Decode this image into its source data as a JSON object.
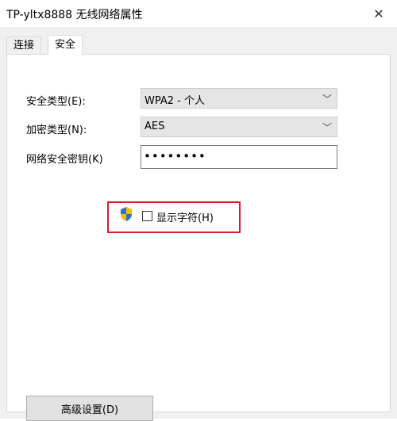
{
  "window": {
    "title": "TP-yltx8888 无线网络属性",
    "close_glyph": "✕"
  },
  "tabs": [
    {
      "label": "连接",
      "active": false
    },
    {
      "label": "安全",
      "active": true
    }
  ],
  "security": {
    "type_label": "安全类型(E):",
    "type_value": "WPA2 - 个人",
    "encryption_label": "加密类型(N):",
    "encryption_value": "AES",
    "key_label": "网络安全密钥(K)",
    "key_value": "••••••••",
    "show_chars_label": "显示字符(H)",
    "show_chars_checked": false
  },
  "advanced_button": "高级设置(D)",
  "icons": {
    "dropdown": "chevron-down-icon",
    "uac": "shield-icon"
  },
  "colors": {
    "highlight": "#d0202a",
    "shield_blue": "#2f6fd6",
    "shield_yellow": "#f2c200"
  }
}
